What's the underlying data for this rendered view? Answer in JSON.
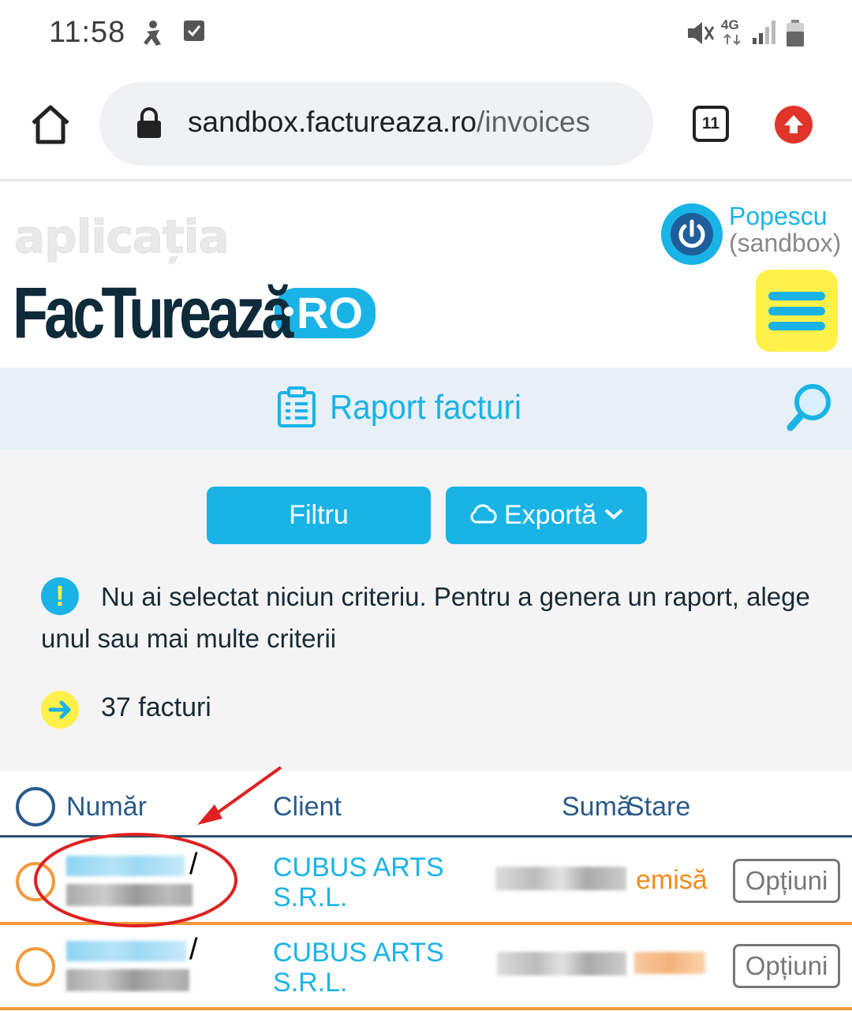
{
  "status_bar": {
    "time": "11:58",
    "network": "4G"
  },
  "browser": {
    "url_domain": "sandbox.factureaza.ro",
    "url_path": "/invoices",
    "tab_count": "11"
  },
  "header": {
    "watermark_logo": "aplicația",
    "brand_name": "FacTurează",
    "brand_suffix": "RO",
    "user_name": "Popescu",
    "user_env": "(sandbox)"
  },
  "page": {
    "title": "Raport facturi"
  },
  "toolbar": {
    "filter_label": "Filtru",
    "export_label": "Exportă"
  },
  "notice": {
    "text": "Nu ai selectat niciun criteriu. Pentru a genera un raport, alege unul sau mai multe criterii"
  },
  "summary": {
    "count_text": "37 facturi"
  },
  "table": {
    "columns": [
      "Număr",
      "Client",
      "Sumă",
      "Stare"
    ],
    "rows": [
      {
        "client_line1": "CUBUS ARTS",
        "client_line2": "S.R.L.",
        "status": "emisă",
        "options_label": "Opțiuni"
      },
      {
        "client_line1": "CUBUS ARTS",
        "client_line2": "S.R.L.",
        "status": "",
        "options_label": "Opțiuni"
      }
    ]
  },
  "colors": {
    "accent": "#1ab3e6",
    "menu_bg": "#fff04a",
    "status_orange": "#f08c1e",
    "annotation_red": "#e02020"
  }
}
